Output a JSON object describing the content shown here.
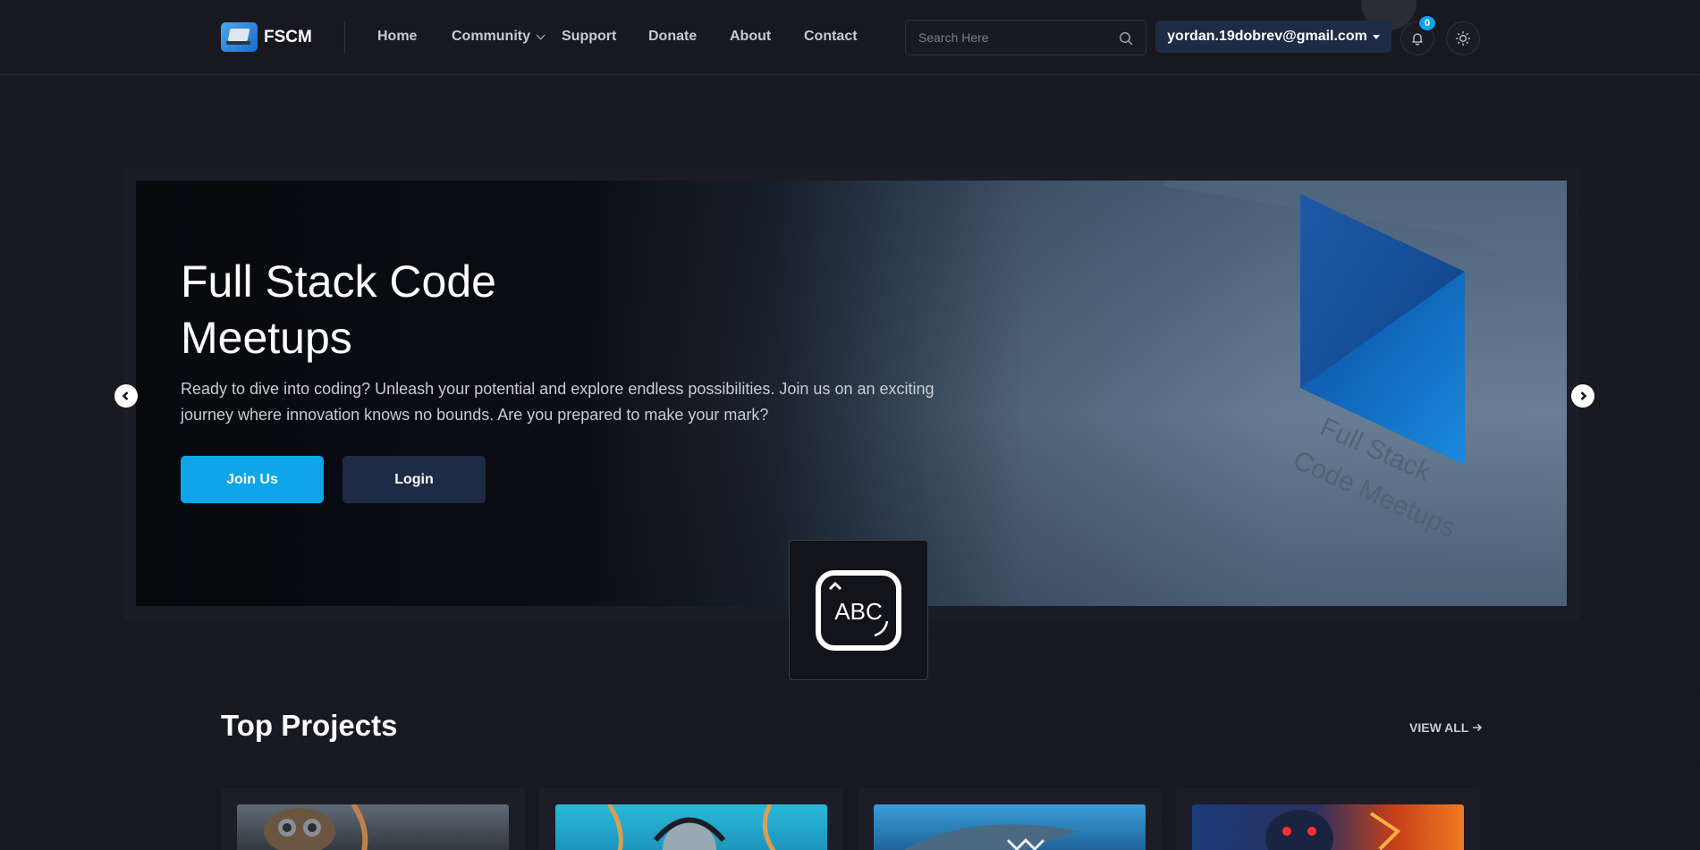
{
  "header": {
    "brand": "FSCM",
    "nav": [
      "Home",
      "Community",
      "Support",
      "Donate",
      "About",
      "Contact"
    ],
    "search_placeholder": "Search Here",
    "user_email": "yordan.19dobrev@gmail.com",
    "notification_count": "0"
  },
  "hero": {
    "title_line1": "Full Stack Code",
    "title_line2": "Meetups",
    "description": "Ready to dive into coding? Unleash your potential and explore endless possibilities. Join us on an exciting journey where innovation knows no bounds. Are you prepared to make your mark?",
    "join_label": "Join Us",
    "login_label": "Login",
    "art_text_line1": "Full Stack",
    "art_text_line2": "Code Meetups"
  },
  "overlay": {
    "abc_label": "ABC"
  },
  "projects": {
    "title": "Top Projects",
    "view_all": "VIEW ALL"
  },
  "colors": {
    "accent": "#0ea5e9",
    "secondary_button": "#1e2b45",
    "background": "#16171f"
  }
}
